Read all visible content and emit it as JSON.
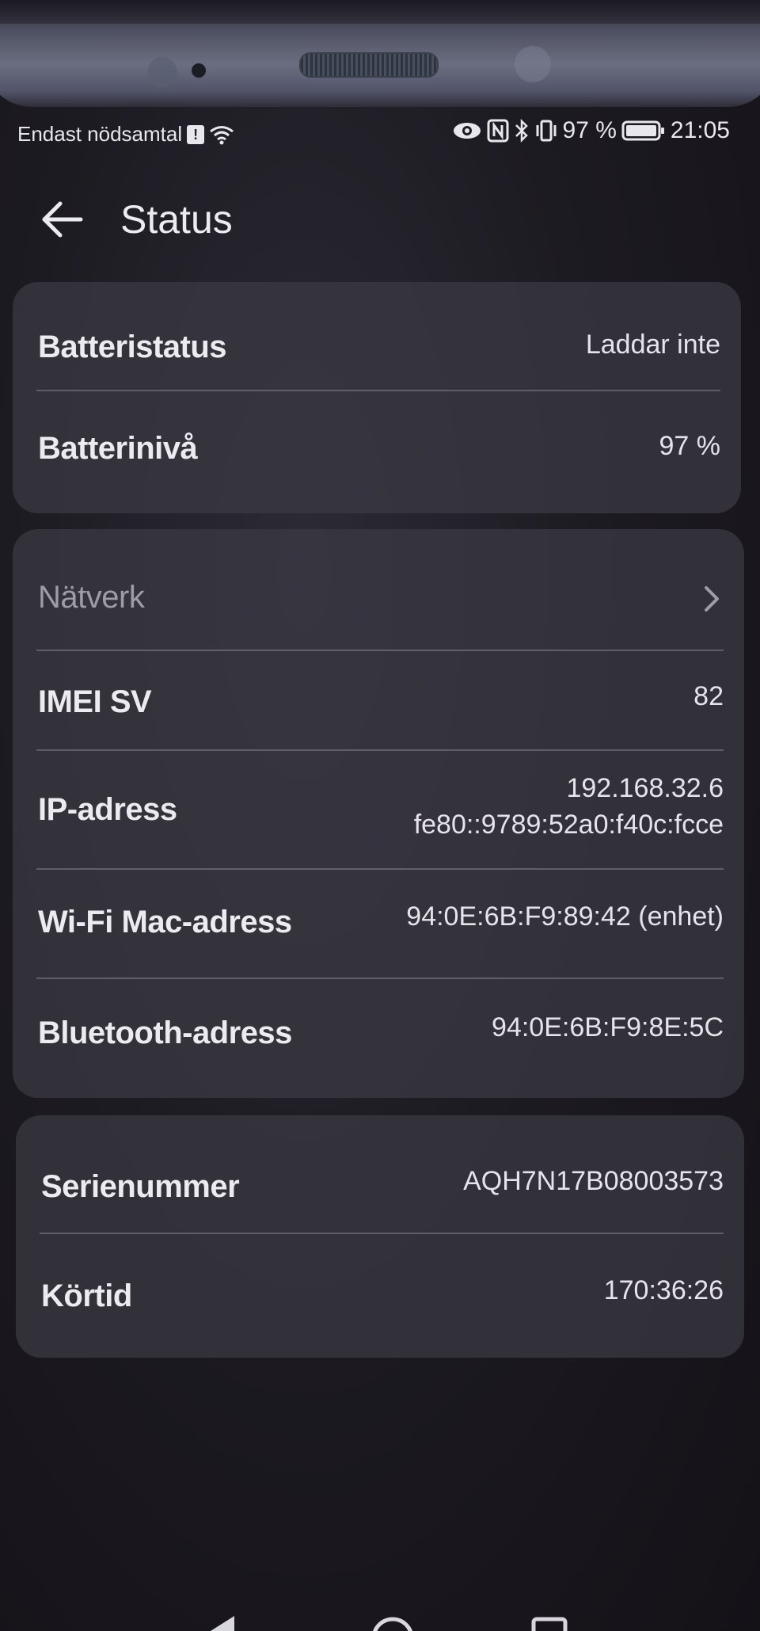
{
  "status_bar": {
    "carrier": "Endast nödsamtal",
    "sim_icon_letter": "!",
    "battery_percent": "97 %",
    "time": "21:05",
    "icons": [
      "sim-icon",
      "wifi-icon",
      "eye-icon",
      "nfc-icon",
      "bluetooth-icon",
      "vibrate-icon",
      "battery-icon"
    ]
  },
  "header": {
    "title": "Status",
    "back_icon": "arrow-left-icon"
  },
  "battery_card": {
    "status_label": "Batteristatus",
    "status_value": "Laddar inte",
    "level_label": "Batterinivå",
    "level_value": "97 %"
  },
  "network_card": {
    "network_label": "Nätverk",
    "imei_label": "IMEI SV",
    "imei_value": "82",
    "ip_label": "IP-adress",
    "ip_value_v4": "192.168.32.6",
    "ip_value_v6": "fe80::9789:52a0:f40c:fcce",
    "wifi_mac_label": "Wi-Fi Mac-adress",
    "wifi_mac_value": "94:0E:6B:F9:89:42 (enhet)",
    "bt_label": "Bluetooth-adress",
    "bt_value": "94:0E:6B:F9:8E:5C"
  },
  "device_card": {
    "serial_label": "Serienummer",
    "serial_value": "AQH7N17B08003573",
    "uptime_label": "Körtid",
    "uptime_value": "170:36:26"
  },
  "colors": {
    "background": "#1d1b22",
    "card": "#3c3a44",
    "text": "#ecebf0",
    "muted": "#9e9ca6"
  }
}
